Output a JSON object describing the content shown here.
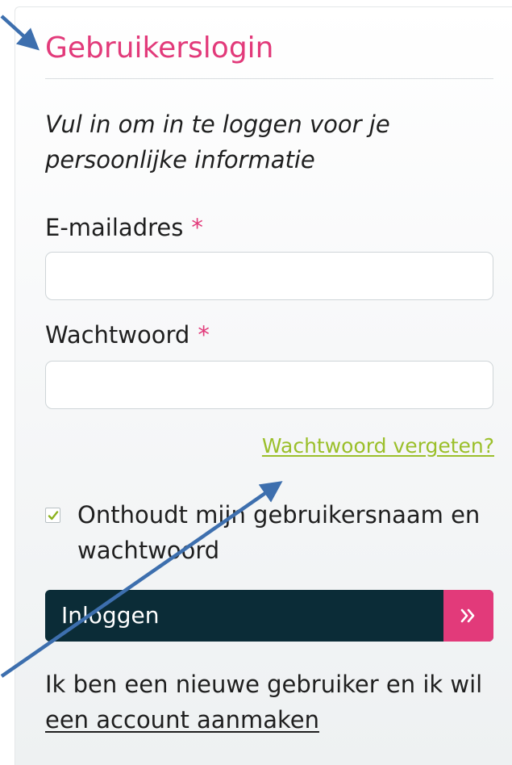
{
  "login": {
    "title": "Gebruikerslogin",
    "intro": "Vul in om in te loggen voor je persoonlijke informatie",
    "email_label": "E-mailadres",
    "password_label": "Wachtwoord",
    "required_marker": "*",
    "email_value": "",
    "password_value": "",
    "forgot_password_link": "Wachtwoord vergeten?",
    "remember_me_label": "Onthoudt mijn gebruikersnaam en wachtwoord",
    "remember_me_checked": true,
    "login_button_label": "Inloggen",
    "login_button_icon": "double-chevron-right-icon",
    "new_user_text": "Ik ben een nieuwe gebruiker en ik wil",
    "create_account_link": "een account aanmaken"
  },
  "colors": {
    "accent_pink": "#e23a7a",
    "link_green": "#9bbf2a",
    "button_navy": "#0b2c37",
    "annotation_arrow": "#3d6fae"
  }
}
